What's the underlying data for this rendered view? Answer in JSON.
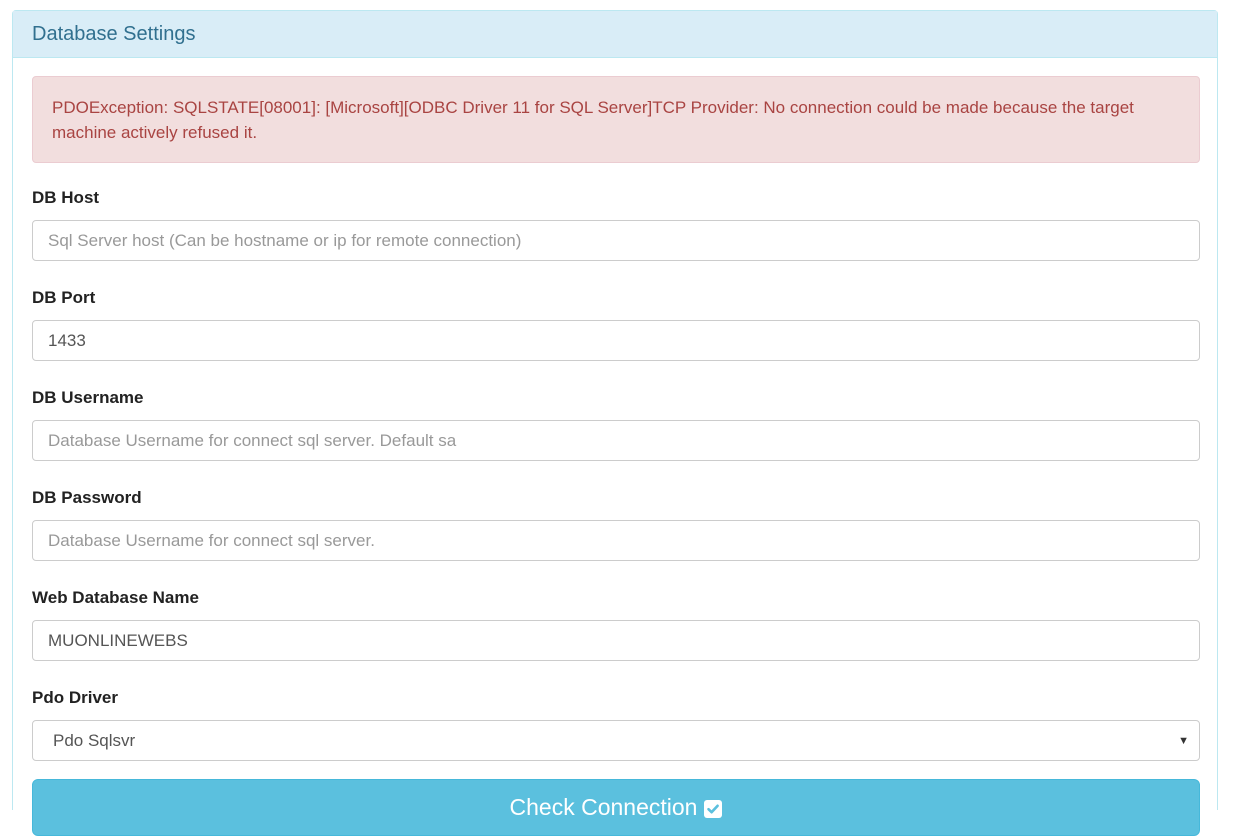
{
  "panel": {
    "title": "Database Settings"
  },
  "alert": {
    "message": "PDOException: SQLSTATE[08001]: [Microsoft][ODBC Driver 11 for SQL Server]TCP Provider: No connection could be made because the target machine actively refused it."
  },
  "fields": {
    "db_host": {
      "label": "DB Host",
      "value": "",
      "placeholder": "Sql Server host (Can be hostname or ip for remote connection)"
    },
    "db_port": {
      "label": "DB Port",
      "value": "1433",
      "placeholder": ""
    },
    "db_username": {
      "label": "DB Username",
      "value": "",
      "placeholder": "Database Username for connect sql server. Default sa"
    },
    "db_password": {
      "label": "DB Password",
      "value": "",
      "placeholder": "Database Username for connect sql server."
    },
    "web_db_name": {
      "label": "Web Database Name",
      "value": "MUONLINEWEBS",
      "placeholder": ""
    },
    "pdo_driver": {
      "label": "Pdo Driver",
      "selected": "Pdo Sqlsvr",
      "caret": "▼"
    }
  },
  "button": {
    "label": "Check Connection",
    "icon": "check-square-icon"
  },
  "colors": {
    "heading_bg": "#d9edf7",
    "heading_text": "#31708f",
    "alert_bg": "#f2dede",
    "alert_text": "#a94442",
    "button_bg": "#5bc0de"
  }
}
